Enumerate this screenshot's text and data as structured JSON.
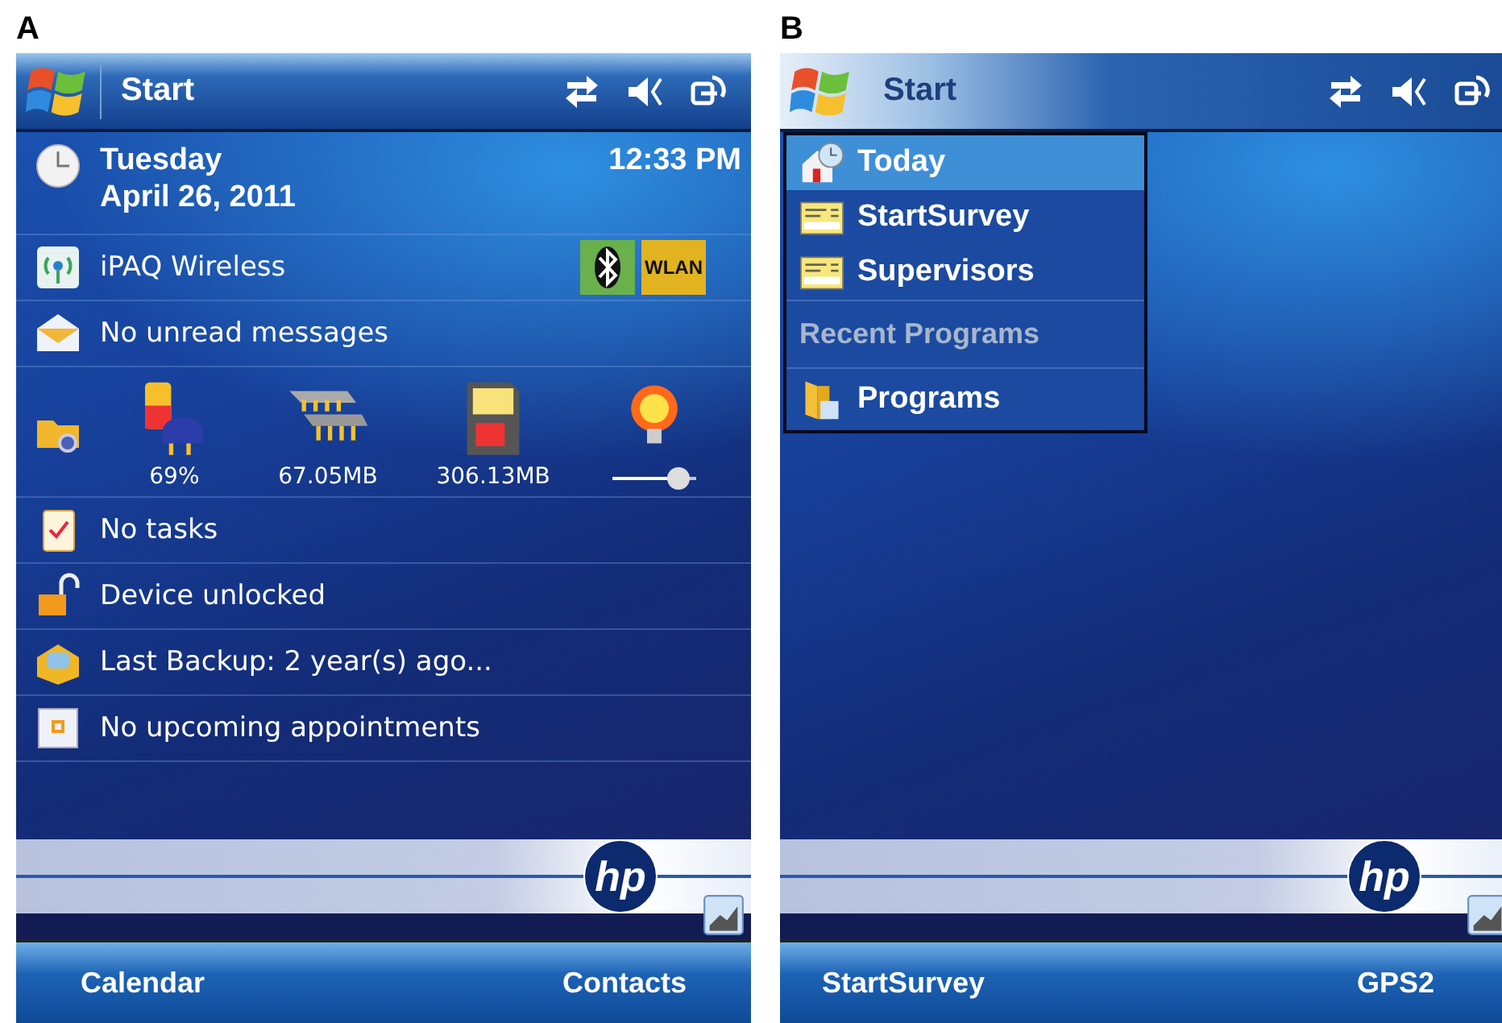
{
  "panel_a": {
    "label": "A",
    "title_bar": {
      "title": "Start"
    },
    "today": [
      {
        "kind": "date",
        "line1": "Tuesday",
        "line2": "April 26, 2011",
        "time": "12:33 PM"
      },
      {
        "kind": "wireless",
        "text": "iPAQ Wireless",
        "badge": "WLAN"
      },
      {
        "kind": "text",
        "text": "No unread messages"
      },
      {
        "kind": "status",
        "readings": [
          "69%",
          "67.05MB",
          "306.13MB"
        ],
        "brightness": {
          "level": 0.9
        }
      },
      {
        "kind": "text",
        "text": "No tasks"
      },
      {
        "kind": "text",
        "text": "Device unlocked"
      },
      {
        "kind": "text",
        "text": "Last Backup: 2 year(s) ago..."
      },
      {
        "kind": "text",
        "text": "No upcoming appointments"
      }
    ],
    "logo": "hp",
    "softkeys": [
      "Calendar",
      "Contacts"
    ]
  },
  "panel_b": {
    "label": "B",
    "title_bar": {
      "title": "Start"
    },
    "start_menu": [
      {
        "kind": "item",
        "label": "Today",
        "selected": true
      },
      {
        "kind": "item",
        "label": "StartSurvey",
        "selected": false
      },
      {
        "kind": "item",
        "label": "Supervisors",
        "selected": false
      },
      {
        "kind": "header",
        "label": "Recent Programs",
        "selected": false
      },
      {
        "kind": "item",
        "label": "Programs",
        "selected": false
      }
    ],
    "logo": "hp",
    "softkeys": [
      "StartSurvey",
      "GPS2"
    ]
  }
}
